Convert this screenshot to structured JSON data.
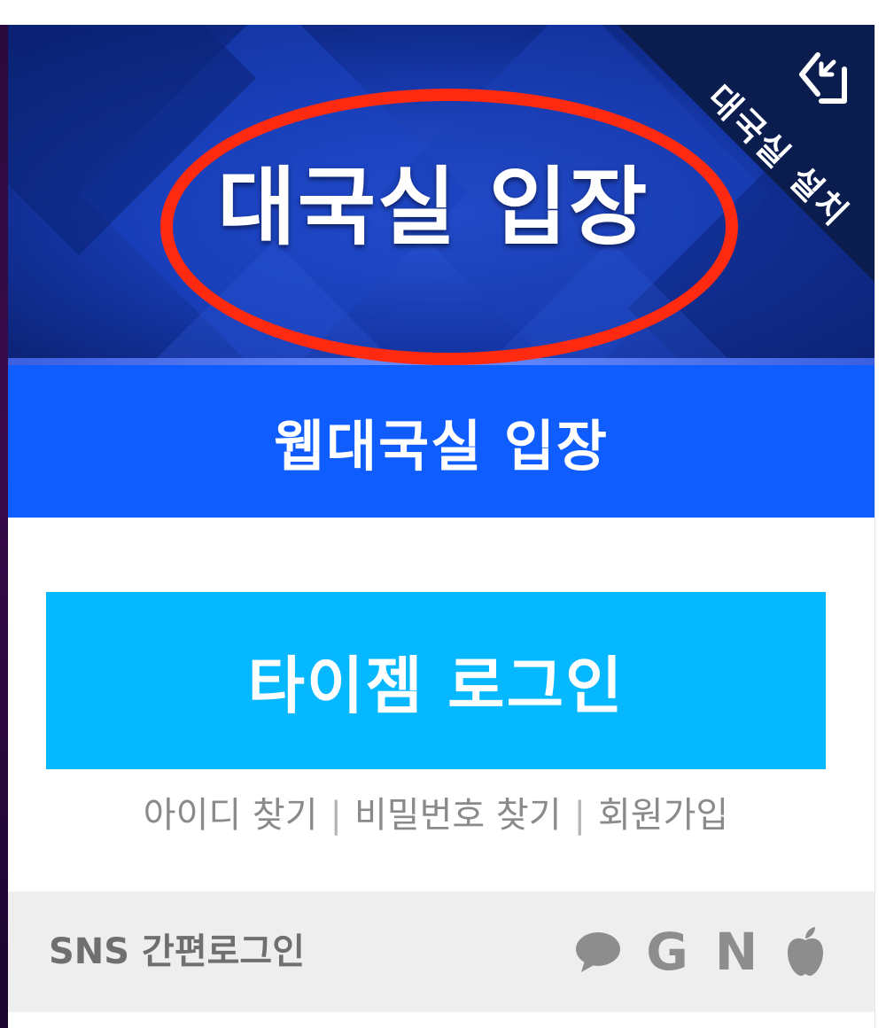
{
  "hero": {
    "title": "대국실 입장",
    "install_label": "대국실 설치"
  },
  "web_enter": {
    "label": "웹대국실 입장"
  },
  "login": {
    "button_label": "타이젬 로그인",
    "links": [
      {
        "label": "아이디 찾기"
      },
      {
        "label": "비밀번호 찾기"
      },
      {
        "label": "회원가입"
      }
    ],
    "separator": "|"
  },
  "sns": {
    "label": "SNS 간편로그인",
    "icons": [
      {
        "name": "kakao-icon"
      },
      {
        "name": "google-icon",
        "glyph": "G"
      },
      {
        "name": "naver-icon",
        "glyph": "N"
      },
      {
        "name": "apple-icon"
      }
    ]
  },
  "colors": {
    "hero_bg": "#0d2a86",
    "web_enter_bg": "#0f5cff",
    "login_bg": "#05b8ff",
    "highlight_ellipse": "#ff2a10",
    "sns_bar_bg": "#eeeeee"
  }
}
